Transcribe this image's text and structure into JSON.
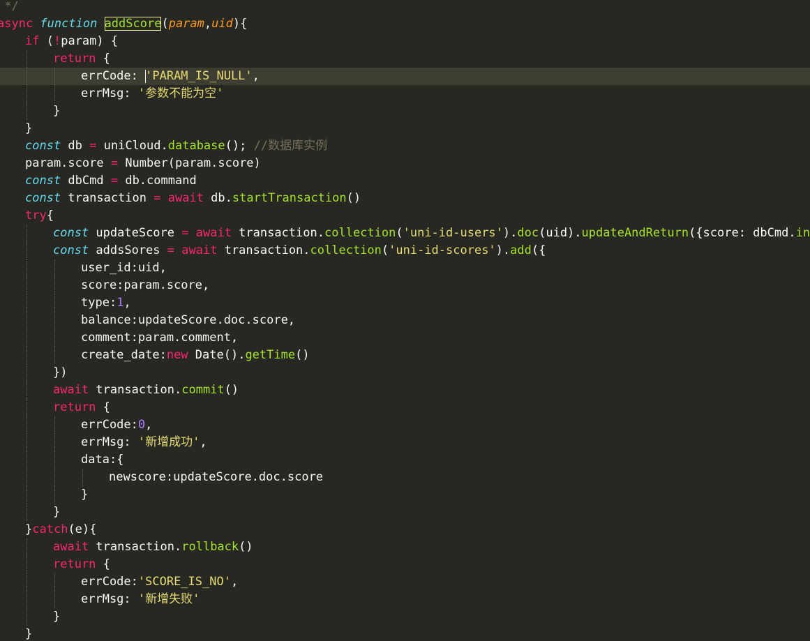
{
  "editor": {
    "theme_colors": {
      "background": "#272822",
      "keyword": "#f92672",
      "storage": "#66d9ef",
      "function": "#a6e22e",
      "string": "#e6db74",
      "number": "#ae81ff",
      "comment": "#75715e",
      "parameter": "#fd971f",
      "active_line": "#3e3d32"
    },
    "lines": [
      {
        "indent": 0,
        "tokens": [
          {
            "t": " */",
            "c": "cm"
          }
        ]
      },
      {
        "indent": 0,
        "tokens": [
          {
            "t": "async ",
            "c": "kw"
          },
          {
            "t": "function",
            "c": "st"
          },
          {
            "t": " "
          },
          {
            "t": "addScore",
            "c": "fn hl"
          },
          {
            "t": "("
          },
          {
            "t": "param",
            "c": "param"
          },
          {
            "t": ","
          },
          {
            "t": "uid",
            "c": "param"
          },
          {
            "t": "){"
          }
        ]
      },
      {
        "indent": 1,
        "tokens": [
          {
            "t": "if",
            "c": "kw"
          },
          {
            "t": " ("
          },
          {
            "t": "!",
            "c": "kw"
          },
          {
            "t": "param) {"
          }
        ]
      },
      {
        "indent": 2,
        "tokens": [
          {
            "t": "return",
            "c": "kw"
          },
          {
            "t": " {"
          }
        ]
      },
      {
        "indent": 3,
        "active": true,
        "tokens": [
          {
            "t": "errCode: "
          },
          {
            "t": "",
            "c": "caret"
          },
          {
            "t": "'PARAM_IS_NULL'",
            "c": "str"
          },
          {
            "t": ","
          }
        ]
      },
      {
        "indent": 3,
        "tokens": [
          {
            "t": "errMsg: "
          },
          {
            "t": "'参数不能为空'",
            "c": "str"
          }
        ]
      },
      {
        "indent": 2,
        "tokens": [
          {
            "t": "}"
          }
        ]
      },
      {
        "indent": 1,
        "tokens": [
          {
            "t": "}"
          }
        ]
      },
      {
        "indent": 1,
        "tokens": [
          {
            "t": "const",
            "c": "st"
          },
          {
            "t": " db "
          },
          {
            "t": "=",
            "c": "kw"
          },
          {
            "t": " uniCloud."
          },
          {
            "t": "database",
            "c": "fn"
          },
          {
            "t": "(); "
          },
          {
            "t": "//数据库实例",
            "c": "cm"
          }
        ]
      },
      {
        "indent": 1,
        "tokens": [
          {
            "t": "param.score "
          },
          {
            "t": "=",
            "c": "kw"
          },
          {
            "t": " Number(param.score)"
          }
        ]
      },
      {
        "indent": 1,
        "tokens": [
          {
            "t": "const",
            "c": "st"
          },
          {
            "t": " dbCmd "
          },
          {
            "t": "=",
            "c": "kw"
          },
          {
            "t": " db.command"
          }
        ]
      },
      {
        "indent": 1,
        "tokens": [
          {
            "t": "const",
            "c": "st"
          },
          {
            "t": " transaction "
          },
          {
            "t": "=",
            "c": "kw"
          },
          {
            "t": " "
          },
          {
            "t": "await",
            "c": "kw"
          },
          {
            "t": " db."
          },
          {
            "t": "startTransaction",
            "c": "fn"
          },
          {
            "t": "()"
          }
        ]
      },
      {
        "indent": 1,
        "tokens": [
          {
            "t": "try",
            "c": "kw"
          },
          {
            "t": "{"
          }
        ]
      },
      {
        "indent": 2,
        "tokens": [
          {
            "t": "const",
            "c": "st"
          },
          {
            "t": " updateScore "
          },
          {
            "t": "=",
            "c": "kw"
          },
          {
            "t": " "
          },
          {
            "t": "await",
            "c": "kw"
          },
          {
            "t": " transaction."
          },
          {
            "t": "collection",
            "c": "fn"
          },
          {
            "t": "("
          },
          {
            "t": "'uni-id-users'",
            "c": "str"
          },
          {
            "t": ")."
          },
          {
            "t": "doc",
            "c": "fn"
          },
          {
            "t": "(uid)."
          },
          {
            "t": "updateAndReturn",
            "c": "fn"
          },
          {
            "t": "({score: dbCmd."
          },
          {
            "t": "inc",
            "c": "fn"
          },
          {
            "t": "("
          },
          {
            "t": "+",
            "c": "kw"
          }
        ]
      },
      {
        "indent": 2,
        "tokens": [
          {
            "t": "const",
            "c": "st"
          },
          {
            "t": " addsSores "
          },
          {
            "t": "=",
            "c": "kw"
          },
          {
            "t": " "
          },
          {
            "t": "await",
            "c": "kw"
          },
          {
            "t": " transaction."
          },
          {
            "t": "collection",
            "c": "fn"
          },
          {
            "t": "("
          },
          {
            "t": "'uni-id-scores'",
            "c": "str"
          },
          {
            "t": ")."
          },
          {
            "t": "add",
            "c": "fn"
          },
          {
            "t": "({"
          }
        ]
      },
      {
        "indent": 3,
        "tokens": [
          {
            "t": "user_id:uid,"
          }
        ]
      },
      {
        "indent": 3,
        "tokens": [
          {
            "t": "score:param.score,"
          }
        ]
      },
      {
        "indent": 3,
        "tokens": [
          {
            "t": "type:"
          },
          {
            "t": "1",
            "c": "num"
          },
          {
            "t": ","
          }
        ]
      },
      {
        "indent": 3,
        "tokens": [
          {
            "t": "balance:updateScore.doc.score,"
          }
        ]
      },
      {
        "indent": 3,
        "tokens": [
          {
            "t": "comment:param.comment,"
          }
        ]
      },
      {
        "indent": 3,
        "tokens": [
          {
            "t": "create_date:"
          },
          {
            "t": "new",
            "c": "kw"
          },
          {
            "t": " Date()."
          },
          {
            "t": "getTime",
            "c": "fn"
          },
          {
            "t": "()"
          }
        ]
      },
      {
        "indent": 2,
        "tokens": [
          {
            "t": "})"
          }
        ]
      },
      {
        "indent": 2,
        "tokens": [
          {
            "t": "await",
            "c": "kw"
          },
          {
            "t": " transaction."
          },
          {
            "t": "commit",
            "c": "fn"
          },
          {
            "t": "()"
          }
        ]
      },
      {
        "indent": 2,
        "tokens": [
          {
            "t": "return",
            "c": "kw"
          },
          {
            "t": " {"
          }
        ]
      },
      {
        "indent": 3,
        "tokens": [
          {
            "t": "errCode:"
          },
          {
            "t": "0",
            "c": "num"
          },
          {
            "t": ","
          }
        ]
      },
      {
        "indent": 3,
        "tokens": [
          {
            "t": "errMsg: "
          },
          {
            "t": "'新增成功'",
            "c": "str"
          },
          {
            "t": ","
          }
        ]
      },
      {
        "indent": 3,
        "tokens": [
          {
            "t": "data:{"
          }
        ]
      },
      {
        "indent": 4,
        "tokens": [
          {
            "t": "newscore:updateScore.doc.score"
          }
        ]
      },
      {
        "indent": 3,
        "tokens": [
          {
            "t": "}"
          }
        ]
      },
      {
        "indent": 2,
        "tokens": [
          {
            "t": "}"
          }
        ]
      },
      {
        "indent": 1,
        "tokens": [
          {
            "t": "}"
          },
          {
            "t": "catch",
            "c": "kw"
          },
          {
            "t": "(e){"
          }
        ]
      },
      {
        "indent": 2,
        "tokens": [
          {
            "t": "await",
            "c": "kw"
          },
          {
            "t": " transaction."
          },
          {
            "t": "rollback",
            "c": "fn"
          },
          {
            "t": "()"
          }
        ]
      },
      {
        "indent": 2,
        "tokens": [
          {
            "t": "return",
            "c": "kw"
          },
          {
            "t": " {"
          }
        ]
      },
      {
        "indent": 3,
        "tokens": [
          {
            "t": "errCode:"
          },
          {
            "t": "'SCORE_IS_NO'",
            "c": "str"
          },
          {
            "t": ","
          }
        ]
      },
      {
        "indent": 3,
        "tokens": [
          {
            "t": "errMsg: "
          },
          {
            "t": "'新增失败'",
            "c": "str"
          }
        ]
      },
      {
        "indent": 2,
        "tokens": [
          {
            "t": "}"
          }
        ]
      },
      {
        "indent": 1,
        "tokens": [
          {
            "t": "}"
          }
        ]
      }
    ]
  }
}
